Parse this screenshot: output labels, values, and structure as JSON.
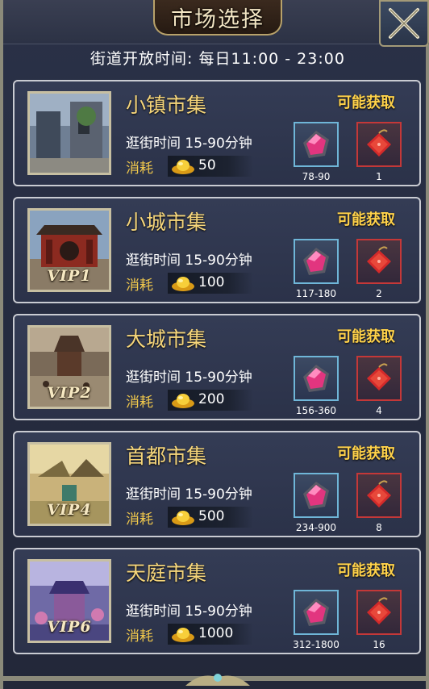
{
  "window": {
    "title": "市场选择",
    "subtitle": "街道开放时间: 每日11:00 - 23:00"
  },
  "markets": [
    {
      "name": "小镇市集",
      "vip": "",
      "duration": "逛街时间 15-90分钟",
      "cost_label": "消耗",
      "cost": "50",
      "obtain": "可能获取",
      "item1_count": "78-90",
      "item2_count": "1"
    },
    {
      "name": "小城市集",
      "vip": "VIP1",
      "duration": "逛街时间 15-90分钟",
      "cost_label": "消耗",
      "cost": "100",
      "obtain": "可能获取",
      "item1_count": "117-180",
      "item2_count": "2"
    },
    {
      "name": "大城市集",
      "vip": "VIP2",
      "duration": "逛街时间 15-90分钟",
      "cost_label": "消耗",
      "cost": "200",
      "obtain": "可能获取",
      "item1_count": "156-360",
      "item2_count": "4"
    },
    {
      "name": "首都市集",
      "vip": "VIP4",
      "duration": "逛街时间 15-90分钟",
      "cost_label": "消耗",
      "cost": "500",
      "obtain": "可能获取",
      "item1_count": "234-900",
      "item2_count": "8"
    },
    {
      "name": "天庭市集",
      "vip": "VIP6",
      "duration": "逛街时间 15-90分钟",
      "cost_label": "消耗",
      "cost": "1000",
      "obtain": "可能获取",
      "item1_count": "312-1800",
      "item2_count": "16"
    }
  ],
  "icons": {
    "close": "close-icon",
    "currency": "gold-ingot-icon",
    "item1": "pink-gem-icon",
    "item2": "red-pouch-icon"
  },
  "colors": {
    "market_name": "#f5d57a",
    "obtain": "#ffd24a",
    "cost_label": "#f2c94c",
    "item_border_blue": "#6fb6d8",
    "item_border_red": "#c43838"
  }
}
